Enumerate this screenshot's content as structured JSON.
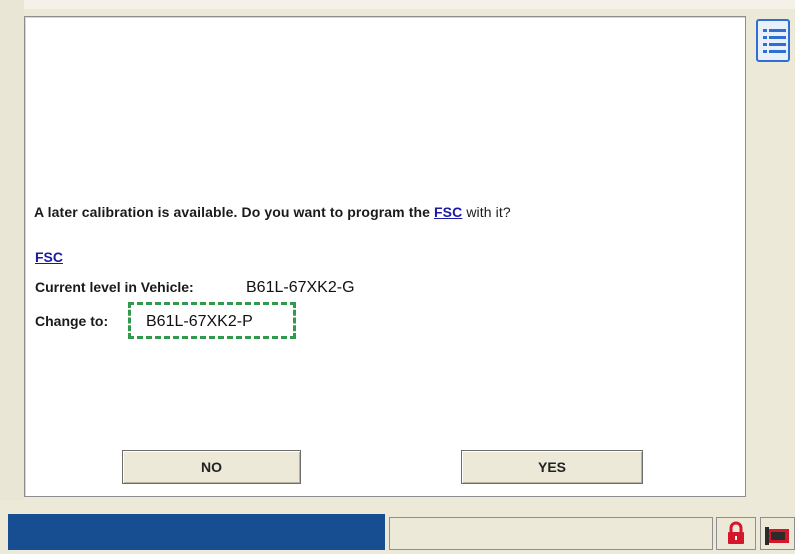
{
  "dialog": {
    "message_prefix": "A later calibration is available. Do you want to program the",
    "message_link": "FSC",
    "message_suffix": "with it?",
    "fsc_link": "FSC",
    "current_level_label": "Current level in Vehicle:",
    "current_level_value": "B61L-67XK2-G",
    "change_to_label": "Change to:",
    "change_to_value": "B61L-67XK2-P",
    "buttons": {
      "no": "NO",
      "yes": "YES"
    }
  },
  "colors": {
    "link": "#1a1aa6",
    "highlight_dash": "#2f9a4d",
    "status_blue": "#174e91",
    "lock_red": "#d6172b",
    "side_icon_blue": "#2d6fd2"
  },
  "icons": {
    "side": "list-menu-icon",
    "lock": "lock-icon",
    "status_tool": "tool-icon"
  }
}
